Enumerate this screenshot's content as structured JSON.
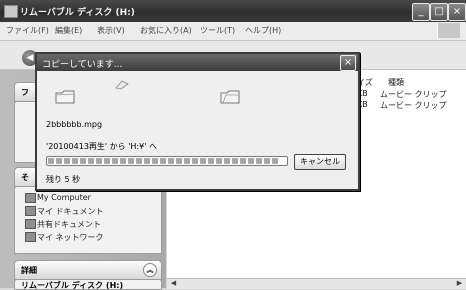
{
  "window": {
    "title": "リムーバブル ディスク (H:)",
    "buttons": {
      "minimize": "_",
      "maximize": "□",
      "close": "×"
    }
  },
  "menu": [
    "ファイル(F)",
    "編集(E)",
    "表示(V)",
    "お気に入り(A)",
    "ツール(T)",
    "ヘルプ(H)"
  ],
  "toolbar": {
    "back": "◀"
  },
  "taskpane": {
    "panel1_title": "フ",
    "panel2_title": "そ",
    "places": [
      "My Computer",
      "マイ ドキュメント",
      "共有ドキュメント",
      "マイ ネットワーク"
    ],
    "details_title": "詳細",
    "details_sub": "リムーバブル ディスク (H:)",
    "collapse_up": "︽"
  },
  "filelist": {
    "columns": {
      "size": "イズ",
      "type": "種類"
    },
    "rows": [
      {
        "size": "KB",
        "type": "ムービー クリップ"
      },
      {
        "size": "KB",
        "type": "ムービー クリップ"
      }
    ]
  },
  "dialog": {
    "title": "コピーしています...",
    "close": "×",
    "filename": "2bbbbbb.mpg",
    "from_to": "'20100413再生' から 'H:¥' へ",
    "cancel": "キャンセル",
    "remaining": "残り 5 秒",
    "progress_fraction": 0.97
  },
  "colors": {
    "title_dark": "#3c3c3c",
    "progress": "#a8a8a8"
  }
}
